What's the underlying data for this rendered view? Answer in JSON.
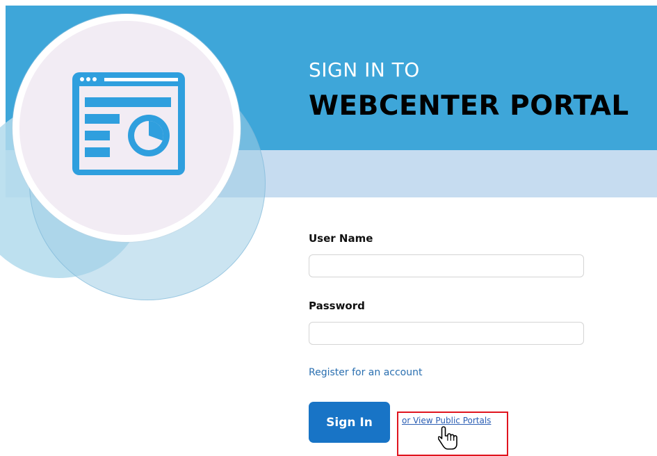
{
  "header": {
    "title_line1": "SIGN IN TO",
    "title_line2": "WEBCENTER PORTAL"
  },
  "form": {
    "username_label": "User Name",
    "username_value": "",
    "password_label": "Password",
    "password_value": "",
    "register_link": "Register for an account",
    "signin_button": "Sign In",
    "public_portals_link": "or View Public Portals"
  },
  "icons": {
    "app": "portal-dashboard-icon",
    "cursor": "hand-pointer-cursor-icon"
  },
  "colors": {
    "header_blue": "#3ea6d9",
    "band_light_blue": "#c6dcf0",
    "button_blue": "#1874c6",
    "link_blue": "#2a6fb0",
    "highlight_red": "#e0141e"
  }
}
